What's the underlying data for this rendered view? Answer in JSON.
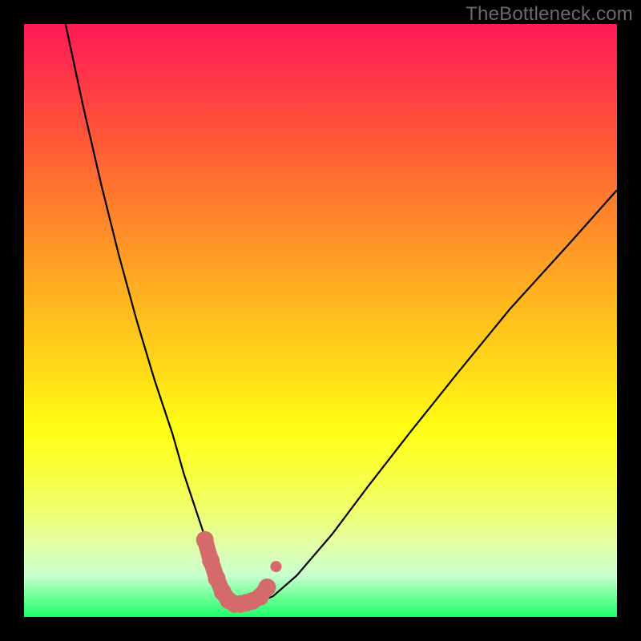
{
  "watermark": {
    "text": "TheBottleneck.com"
  },
  "colors": {
    "frame": "#000000",
    "gradient_css": "linear-gradient(to bottom, #ff1a56 0%, #ff2f4c 7%, #ff5a36 20%, #ff8a2a 34%, #ffb71f 47%, #ffe017 60%, #ffff14 68%, #f8ff3a 75%, #efff6e 82%, #e2ffa8 88%, #c8ffcf 93%, #7eff9e 96%, #1aff68 100%)",
    "curve_stroke": "#000000",
    "trough_stroke": "#d46a6a"
  },
  "chart_data": {
    "type": "line",
    "title": "",
    "xlabel": "",
    "ylabel": "",
    "xlim": [
      0,
      100
    ],
    "ylim": [
      0,
      100
    ],
    "series": [
      {
        "name": "bottleneck-curve",
        "x": [
          7,
          10,
          13,
          16,
          19,
          22,
          25,
          27,
          29,
          31,
          32.5,
          34,
          35.5,
          37,
          39,
          42,
          46,
          52,
          58,
          65,
          73,
          82,
          92,
          100
        ],
        "y": [
          100,
          86,
          73,
          61,
          50,
          40,
          31,
          24,
          18,
          12,
          8,
          5,
          3,
          2.2,
          2.3,
          3.5,
          7,
          14,
          22,
          31,
          41,
          52,
          63,
          72
        ]
      }
    ],
    "trough_highlight": {
      "x": [
        30.5,
        31.5,
        32.5,
        33.5,
        34.5,
        35.5,
        36.5,
        37.5,
        38.5,
        39.8,
        41.0
      ],
      "y": [
        13.0,
        9.5,
        6.5,
        4.2,
        2.8,
        2.2,
        2.2,
        2.4,
        2.7,
        3.4,
        5.0
      ]
    }
  }
}
